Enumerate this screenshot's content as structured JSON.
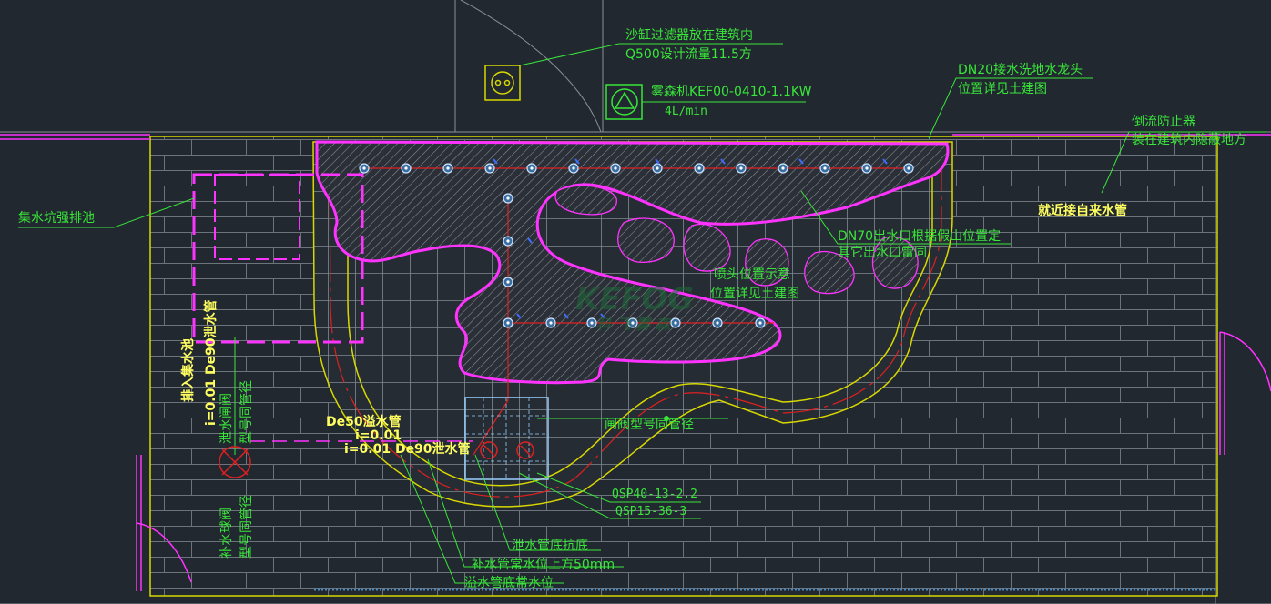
{
  "labels": {
    "sand_filter_line1": "沙缸过滤器放在建筑内",
    "sand_filter_line2": "Q500设计流量11.5方",
    "fog_machine_line1": "雾森机KEF00-0410-1.1KW",
    "fog_machine_line2": "4L/min",
    "dn20_line1": "DN20接水洗地水龙头",
    "dn20_line2": "位置详见土建图",
    "backflow_line1": "倒流防止器",
    "backflow_line2": "装在建筑内隐蔽地方",
    "sump_drain": "集水坑强排池",
    "tap_water": "就近接自来水管",
    "dn70_line1": "DN70出水口根据假山位置定",
    "dn70_line2": "其它出水口雷同",
    "nozzle_line1": "喷头位置示意",
    "nozzle_line2": "位置详见土建图",
    "into_sump": "排入集水池",
    "de90_drain_vertical": "i=0.01 De90泄水管",
    "drain_valve_line1": "泄水闸阀",
    "drain_valve_line2": "型号同管径",
    "makeup_valve_line1": "补水球阀",
    "makeup_valve_line2": "型号同管径",
    "de50_overflow": "De50溢水管",
    "slope_1": "i=0.01",
    "de90_drain": "i=0.01 De90泄水管",
    "valve_same_size": "闸阀型号同管径",
    "pump1": "QSP40-13-2.2",
    "pump2": "QSP15-36-3",
    "drain_bottom": "泄水管底抗底",
    "makeup_level": "补水管常水位上方50mm",
    "overflow_level": "溢水管底常水位",
    "watermark": "KEFOG",
    "watermark_sub": "科 飞 雾 森"
  },
  "colors": {
    "background": "#212830",
    "label_green": "#39e639",
    "label_yellow": "#ffff60",
    "pipe_magenta": "#ff33ff",
    "pool_yellow": "#d8d800",
    "brick_grey": "#7a7f86",
    "pipe_red": "#e02020",
    "equipment_blue": "#9ad0ff"
  },
  "icons": [
    "sand-filter-icon",
    "fog-machine-icon",
    "valve-icon",
    "pump-icon",
    "nozzle-icon"
  ]
}
